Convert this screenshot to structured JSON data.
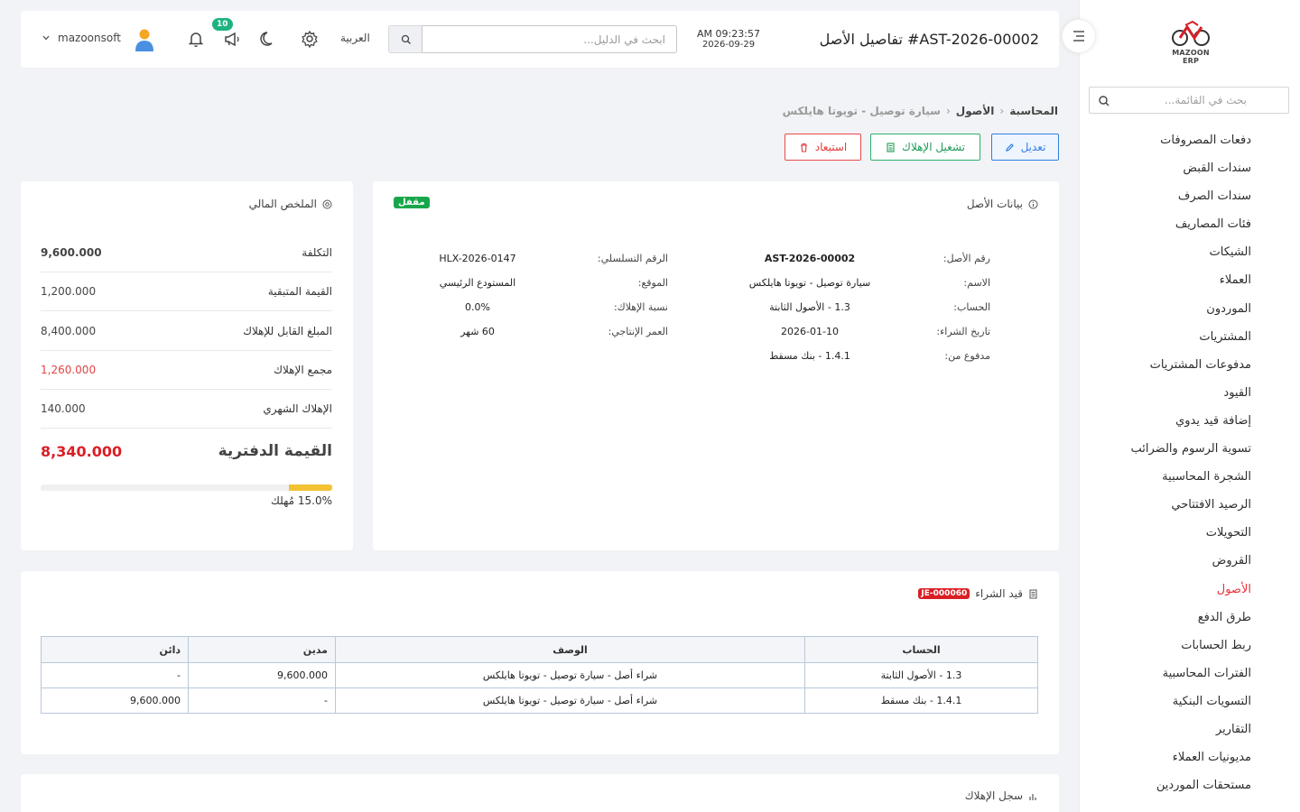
{
  "sidebar": {
    "logo_text": "MAZOON ERP",
    "search_placeholder": "بحث في القائمة...",
    "partial_item": "...",
    "items": [
      {
        "label": "دفعات المصروفات"
      },
      {
        "label": "سندات القبض"
      },
      {
        "label": "سندات الصرف"
      },
      {
        "label": "فئات المصاريف"
      },
      {
        "label": "الشيكات"
      },
      {
        "label": "العملاء"
      },
      {
        "label": "الموردون"
      },
      {
        "label": "المشتريات"
      },
      {
        "label": "مدفوعات المشتريات"
      },
      {
        "label": "القيود"
      },
      {
        "label": "إضافة قيد يدوي"
      },
      {
        "label": "تسوية الرسوم والضرائب"
      },
      {
        "label": "الشجرة المحاسبية"
      },
      {
        "label": "الرصيد الافتتاحي"
      },
      {
        "label": "التحويلات"
      },
      {
        "label": "القروض"
      },
      {
        "label": "الأصول",
        "active": true
      },
      {
        "label": "طرق الدفع"
      },
      {
        "label": "ربط الحسابات"
      },
      {
        "label": "الفترات المحاسبية"
      },
      {
        "label": "التسويات البنكية"
      },
      {
        "label": "التقارير"
      },
      {
        "label": "مديونيات العملاء"
      },
      {
        "label": "مستحقات الموردين"
      }
    ]
  },
  "header": {
    "title": "تفاصيل الأصل #AST-2026-00002",
    "time": "AM 09:23:57",
    "date": "2026-09-29",
    "search_placeholder": "ابحث في الدليل...",
    "language": "العربية",
    "notification_badge": "10",
    "username": "mazoonsoft"
  },
  "breadcrumb": {
    "root": "المحاسبة",
    "parent": "الأصول",
    "current": "سيارة توصيل - تويوتا هايلكس"
  },
  "actions": {
    "edit": "تعديل",
    "run_depreciation": "تشغيل الإهلاك",
    "dispose": "استبعاد"
  },
  "asset_card": {
    "title": "بيانات الأصل",
    "status": "مقفل",
    "fields": {
      "asset_no_label": "رقم الأصل:",
      "asset_no": "AST-2026-00002",
      "name_label": "الاسم:",
      "name": "سيارة توصيل - تويوتا هايلكس",
      "account_label": "الحساب:",
      "account": "1.3 - الأصول الثابتة",
      "purchase_date_label": "تاريخ الشراء:",
      "purchase_date": "2026-01-10",
      "paid_from_label": "مدفوع من:",
      "paid_from": "1.4.1 - بنك مسقط",
      "serial_label": "الرقم التسلسلي:",
      "serial": "HLX-2026-0147",
      "location_label": "الموقع:",
      "location": "المستودع الرئيسي",
      "dep_rate_label": "نسبة الإهلاك:",
      "dep_rate": "0.0%",
      "useful_life_label": "العمر الإنتاجي:",
      "useful_life": "60 شهر"
    }
  },
  "financial_summary": {
    "title": "الملخص المالي",
    "rows": [
      {
        "label": "التكلفة",
        "value": "9,600.000",
        "bold": true
      },
      {
        "label": "القيمة المتبقية",
        "value": "1,200.000"
      },
      {
        "label": "المبلغ القابل للإهلاك",
        "value": "8,400.000"
      },
      {
        "label": "مجمع الإهلاك",
        "value": "1,260.000",
        "red": true
      },
      {
        "label": "الإهلاك الشهري",
        "value": "140.000"
      }
    ],
    "book_value_label": "القيمة الدفترية",
    "book_value": "8,340.000",
    "depreciated_fraction": 0.15,
    "depreciated_text": "15.0% مُهلك"
  },
  "purchase_entry": {
    "title": "قيد الشراء",
    "entry_no": "JE-000060",
    "columns": {
      "account": "الحساب",
      "description": "الوصف",
      "debit": "مدين",
      "credit": "دائن"
    },
    "rows": [
      {
        "account": "1.3 - الأصول الثابتة",
        "description": "شراء أصل - سيارة توصيل - تويوتا هايلكس",
        "debit": "9,600.000",
        "credit": "-"
      },
      {
        "account": "1.4.1 - بنك مسقط",
        "description": "شراء أصل - سيارة توصيل - تويوتا هايلكس",
        "debit": "-",
        "credit": "9,600.000"
      }
    ]
  },
  "depreciation_log": {
    "title": "سجل الإهلاك"
  },
  "colors": {
    "accent_red": "#d91f26",
    "primary_blue": "#2f7ee3",
    "success_green": "#17a74a",
    "progress_yellow": "#f2c233"
  }
}
